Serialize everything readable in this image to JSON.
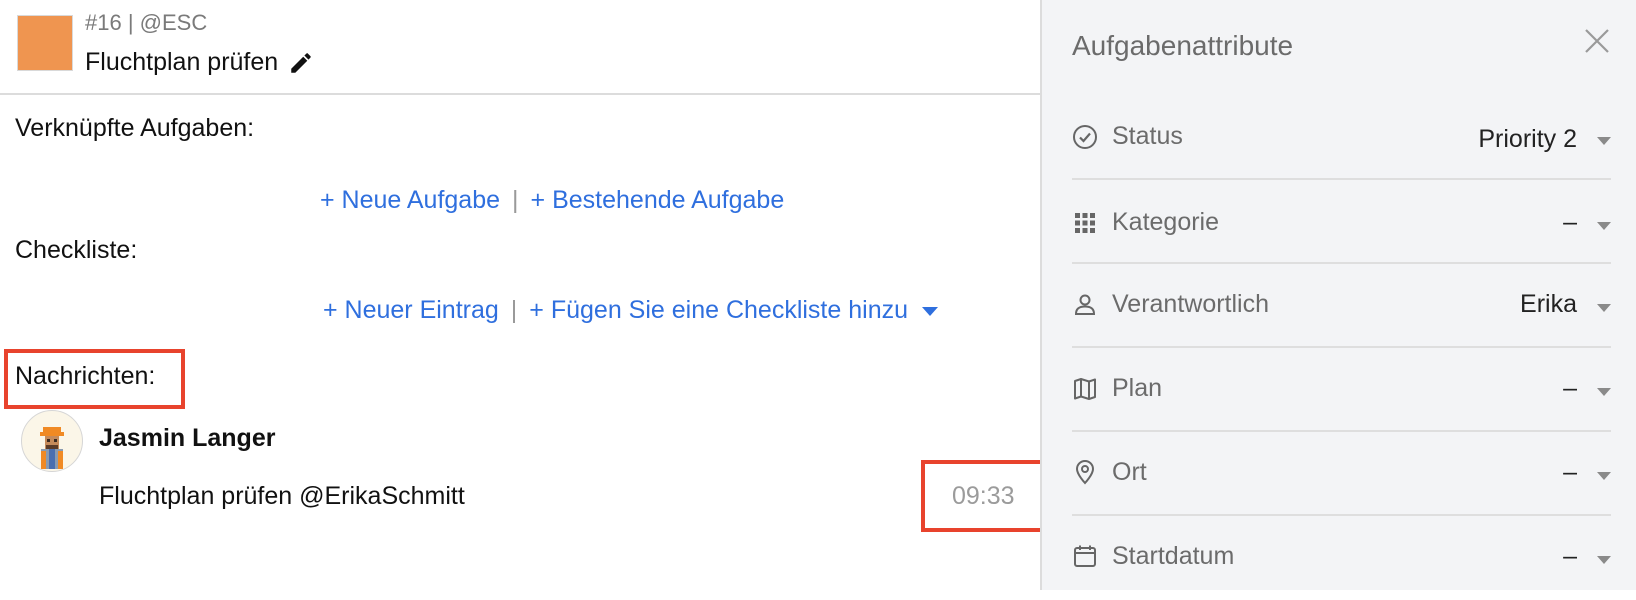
{
  "task": {
    "ref": "#16 | @ESC",
    "title": "Fluchtplan prüfen",
    "color": "#ef9550"
  },
  "linked_tasks": {
    "label": "Verknüpfte Aufgaben:",
    "new_label": "+ Neue Aufgabe",
    "separator": "|",
    "existing_label": "+ Bestehende Aufgabe"
  },
  "checklist": {
    "label": "Checkliste:",
    "new_entry_label": "+ Neuer Eintrag",
    "separator": "|",
    "add_checklist_label": "+ Fügen Sie eine Checkliste hinzu"
  },
  "messages": {
    "label": "Nachrichten:",
    "items": [
      {
        "author": "Jasmin Langer",
        "text": "Fluchtplan prüfen @ErikaSchmitt",
        "time": "09:33"
      }
    ]
  },
  "panel": {
    "title": "Aufgabenattribute",
    "attributes": [
      {
        "icon": "check-circle-icon",
        "label": "Status",
        "value": "Priority 2"
      },
      {
        "icon": "grid-icon",
        "label": "Kategorie",
        "value": "–"
      },
      {
        "icon": "person-icon",
        "label": "Verantwortlich",
        "value": "Erika"
      },
      {
        "icon": "map-icon",
        "label": "Plan",
        "value": "–"
      },
      {
        "icon": "location-pin-icon",
        "label": "Ort",
        "value": "–"
      },
      {
        "icon": "calendar-icon",
        "label": "Startdatum",
        "value": "–"
      }
    ]
  },
  "colors": {
    "link": "#2f6fde",
    "highlight": "#e8432d",
    "panel_bg": "#f3f4f6"
  }
}
